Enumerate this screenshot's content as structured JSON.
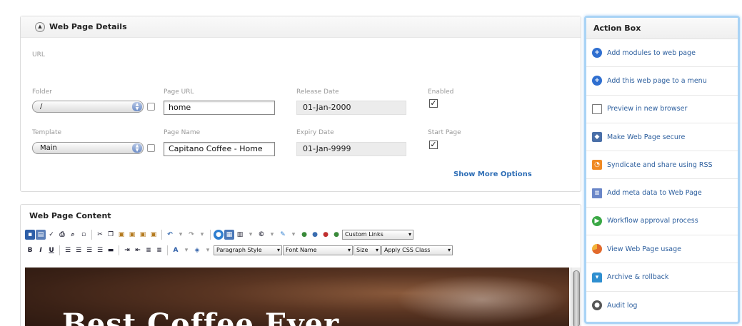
{
  "details": {
    "title": "Web Page Details",
    "url_label": "URL",
    "folder": {
      "label": "Folder",
      "value": "/"
    },
    "page_url": {
      "label": "Page URL",
      "value": "home"
    },
    "release_date": {
      "label": "Release Date",
      "value": "01-Jan-2000"
    },
    "enabled": {
      "label": "Enabled",
      "checked": true
    },
    "template": {
      "label": "Template",
      "value": "Main"
    },
    "page_name": {
      "label": "Page Name",
      "value": "Capitano Coffee - Home"
    },
    "expiry_date": {
      "label": "Expiry Date",
      "value": "01-Jan-9999"
    },
    "start_page": {
      "label": "Start Page",
      "checked": true
    },
    "show_more": "Show More Options"
  },
  "content": {
    "title": "Web Page Content",
    "toolbar": {
      "custom_links": "Custom Links",
      "paragraph_style": "Paragraph Style",
      "font_name": "Font Name",
      "size": "Size",
      "css_class": "Apply CSS Class",
      "bold": "B",
      "italic": "I",
      "underline": "U",
      "font_color": "A"
    },
    "hero_text": "Best Coffee Ever"
  },
  "action_box": {
    "title": "Action Box",
    "items": [
      {
        "label": "Add modules to web page",
        "icon": "add-circle-icon",
        "color": "#2f6fd0"
      },
      {
        "label": "Add this web page to a menu",
        "icon": "add-circle-icon",
        "color": "#2f6fd0"
      },
      {
        "label": "Preview in new browser",
        "icon": "window-icon",
        "color": "#ffffff"
      },
      {
        "label": "Make Web Page secure",
        "icon": "shield-icon",
        "color": "#4a6fa8"
      },
      {
        "label": "Syndicate and share using RSS",
        "icon": "rss-icon",
        "color": "#f08a24"
      },
      {
        "label": "Add meta data to Web Page",
        "icon": "document-icon",
        "color": "#6a86c8"
      },
      {
        "label": "Workflow approval process",
        "icon": "play-circle-icon",
        "color": "#3aa845"
      },
      {
        "label": "View Web Page usage",
        "icon": "pie-chart-icon",
        "color": "#e26a2c"
      },
      {
        "label": "Archive & rollback",
        "icon": "archive-icon",
        "color": "#2f8fd0"
      },
      {
        "label": "Audit log",
        "icon": "group-icon",
        "color": "#555555"
      }
    ]
  }
}
